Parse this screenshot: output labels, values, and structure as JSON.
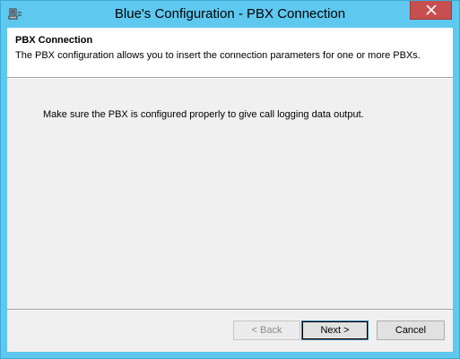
{
  "window": {
    "title": "Blue's Configuration - PBX Connection"
  },
  "header": {
    "title": "PBX Connection",
    "description": "The PBX configuration allows you to insert the connection parameters for one or more PBXs."
  },
  "body": {
    "instruction": "Make sure the PBX is configured properly to give call logging data output."
  },
  "buttons": {
    "back": "< Back",
    "next": "Next >",
    "cancel": "Cancel"
  },
  "colors": {
    "titlebar": "#5ec8ef",
    "close": "#c74f4f",
    "client": "#f0f0f0"
  },
  "icons": {
    "app": "app-icon",
    "close": "close-icon"
  }
}
